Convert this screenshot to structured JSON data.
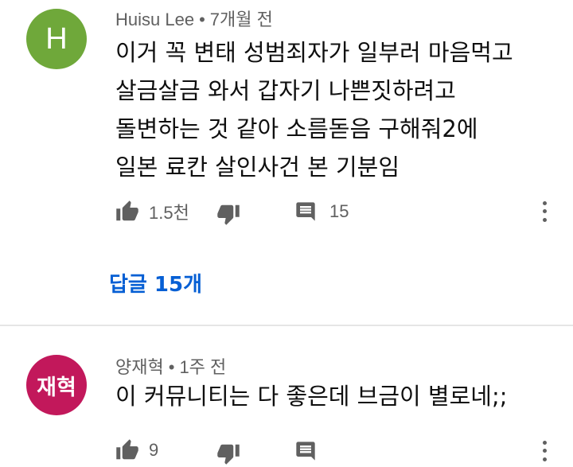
{
  "comments": [
    {
      "avatar_letter": "H",
      "avatar_color": "#6fa83a",
      "author": "Huisu Lee",
      "separator": "•",
      "time": "7개월 전",
      "text": "이거 꼭 변태 성범죄자가 일부러 마음먹고\n살금살금 와서 갑자기 나쁜짓하려고\n돌변하는 것 같아 소름돋음 구해줘2에\n일본 료칸 살인사건 본 기분임",
      "likes": "1.5천",
      "replies_count": "15",
      "replies_link": "답글 15개"
    },
    {
      "avatar_letter": "재혁",
      "avatar_color": "#c2185b",
      "author": "양재혁",
      "separator": "•",
      "time": "1주 전",
      "text": "이 커뮤니티는 다 좋은데 브금이 별로네;;",
      "likes": "9"
    }
  ],
  "icons": {
    "like": "thumbs-up-icon",
    "dislike": "thumbs-down-icon",
    "reply": "comment-icon",
    "more": "more-vertical-icon"
  },
  "colors": {
    "link": "#065fd4",
    "secondary_text": "#606060",
    "icon": "#606060"
  }
}
